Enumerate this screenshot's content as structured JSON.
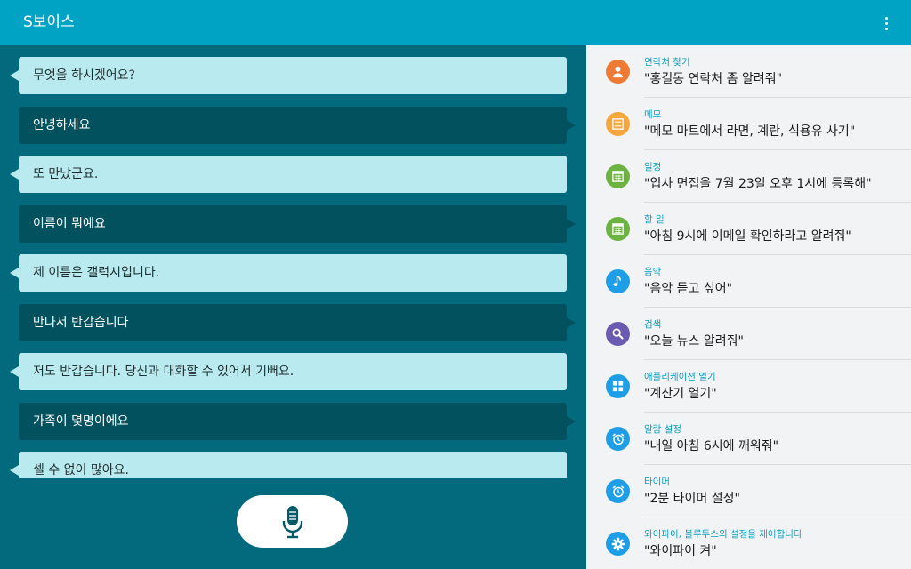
{
  "app": {
    "title": "S보이스"
  },
  "colors": {
    "appbar": "#01a3c4",
    "chat_bg": "#03697c",
    "system_bubble": "#b8eaef",
    "user_bubble": "#02515e",
    "accent_text": "#06a0c0"
  },
  "chat": {
    "messages": [
      {
        "from": "system",
        "text": "무엇을 하시겠어요?"
      },
      {
        "from": "user",
        "text": "안녕하세요"
      },
      {
        "from": "system",
        "text": "또 만났군요."
      },
      {
        "from": "user",
        "text": "이름이 뭐예요"
      },
      {
        "from": "system",
        "text": "제 이름은 갤럭시입니다."
      },
      {
        "from": "user",
        "text": "만나서 반갑습니다"
      },
      {
        "from": "system",
        "text": "저도 반갑습니다. 당신과 대화할 수 있어서 기뻐요."
      },
      {
        "from": "user",
        "text": "가족이 몇명이에요"
      },
      {
        "from": "system",
        "text": "셀 수 없이 많아요."
      }
    ]
  },
  "suggestions": [
    {
      "category": "연락처 찾기",
      "example": "\"홍길동 연락처 좀 알려줘\"",
      "icon": "person-icon",
      "color": "#ef7a33"
    },
    {
      "category": "메모",
      "example": "\"메모 마트에서 라면, 계란, 식용유 사기\"",
      "icon": "memo-icon",
      "color": "#f5a63e"
    },
    {
      "category": "일정",
      "example": "\"입사 면접을 7월 23일 오후 1시에 등록해\"",
      "icon": "calendar-icon",
      "color": "#6cb33f"
    },
    {
      "category": "할 일",
      "example": "\"아침 9시에 이메일 확인하라고 알려줘\"",
      "icon": "task-icon",
      "color": "#6cb33f"
    },
    {
      "category": "음악",
      "example": "\"음악 듣고 싶어\"",
      "icon": "music-note-icon",
      "color": "#1e9ee6"
    },
    {
      "category": "검색",
      "example": "\"오늘 뉴스 알려줘\"",
      "icon": "search-icon",
      "color": "#6a5bb0"
    },
    {
      "category": "애플리케이션 열기",
      "example": "\"계산기 열기\"",
      "icon": "apps-grid-icon",
      "color": "#1e9ee6"
    },
    {
      "category": "알람 설정",
      "example": "\"내일 아침 6시에 깨워줘\"",
      "icon": "alarm-clock-icon",
      "color": "#1e9ee6"
    },
    {
      "category": "타이머",
      "example": "\"2분 타이머 설정\"",
      "icon": "timer-icon",
      "color": "#1e9ee6"
    },
    {
      "category": "와이파이, 블루투스의 설정을 제어합니다",
      "example": "\"와이파이 켜\"",
      "icon": "gear-icon",
      "color": "#1e9ee6"
    }
  ]
}
